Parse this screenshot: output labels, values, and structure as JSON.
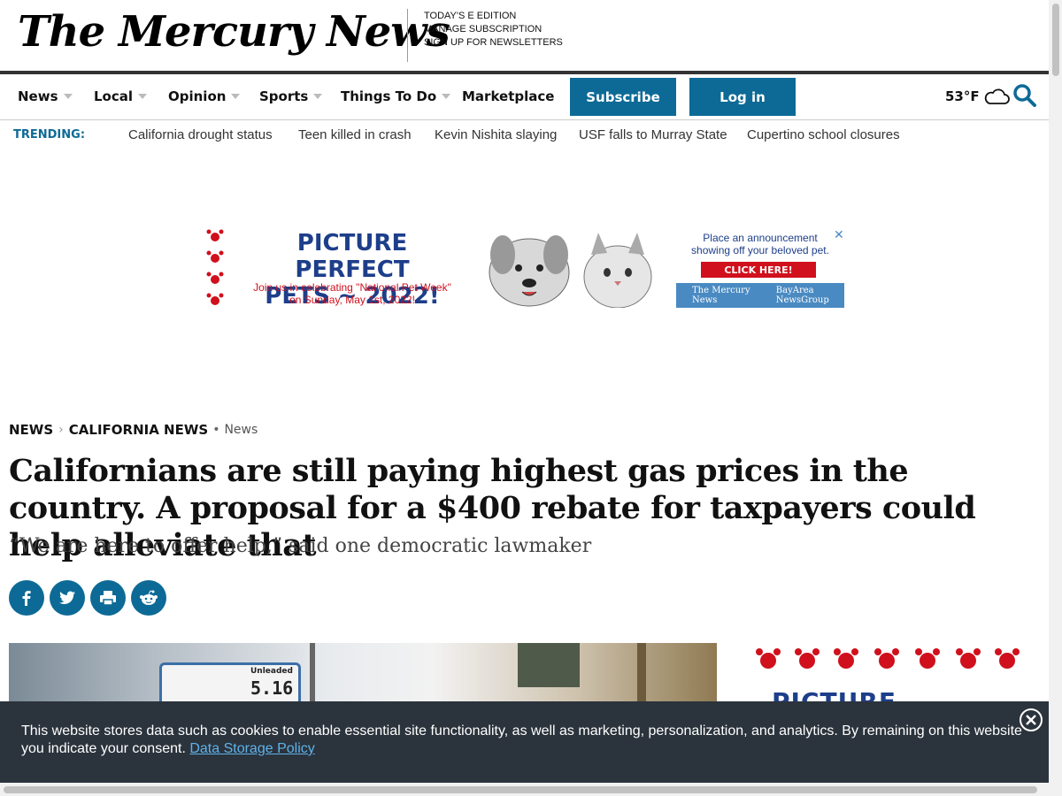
{
  "masthead": {
    "logo": "The Mercury News",
    "links": [
      "TODAY'S E EDITION",
      "MANAGE SUBSCRIPTION",
      "SIGN UP FOR NEWSLETTERS"
    ]
  },
  "nav": {
    "items": [
      {
        "label": "News",
        "has_dropdown": true
      },
      {
        "label": "Local",
        "has_dropdown": true
      },
      {
        "label": "Opinion",
        "has_dropdown": true
      },
      {
        "label": "Sports",
        "has_dropdown": true
      },
      {
        "label": "Things To Do",
        "has_dropdown": true
      },
      {
        "label": "Marketplace",
        "has_dropdown": false
      }
    ],
    "subscribe_label": "Subscribe",
    "login_label": "Log in",
    "weather": "53°F",
    "weather_icon": "cloud-icon",
    "search_icon": "search-icon"
  },
  "trending": {
    "label": "TRENDING:",
    "items": [
      "California drought status",
      "Teen killed in crash",
      "Kevin Nishita slaying",
      "USF falls to Murray State",
      "Cupertino school closures"
    ]
  },
  "ad": {
    "title_line1": "PICTURE PERFECT",
    "title_line2": "PETS ~ 2022!",
    "sub_line1": "Join us in celebrating \"National Pet Week\"",
    "sub_line2": "on Sunday, May 1st, 2022!",
    "right_line1": "Place an announcement",
    "right_line2": "showing off your beloved pet.",
    "cta": "CLICK HERE!",
    "footer_brand": "The Mercury News",
    "footer_group": "BayArea NewsGroup"
  },
  "article": {
    "breadcrumb": [
      "NEWS",
      "CALIFORNIA NEWS"
    ],
    "tag": "News",
    "headline": "Californians are still paying highest gas prices in the country. A proposal for a $400 rebate for taxpayers could help alleviate that",
    "subhead": "“We are here to offer help,” said one democratic lawmaker",
    "share": [
      "facebook-icon",
      "twitter-icon",
      "print-icon",
      "reddit-icon"
    ],
    "image_sign_label": "Unleaded",
    "image_sign_price": "5.16"
  },
  "side_ad": {
    "title": "PICTURE PERFECT"
  },
  "cookie": {
    "text": "This website stores data such as cookies to enable essential site functionality, as well as marketing, personalization, and analytics. By remaining on this website you indicate your consent.",
    "link": "Data Storage Policy"
  },
  "colors": {
    "brand_blue": "#0d6a96",
    "ad_navy": "#1d3e8a",
    "ad_red": "#d0101c",
    "banner_bg": "#2b333c"
  }
}
